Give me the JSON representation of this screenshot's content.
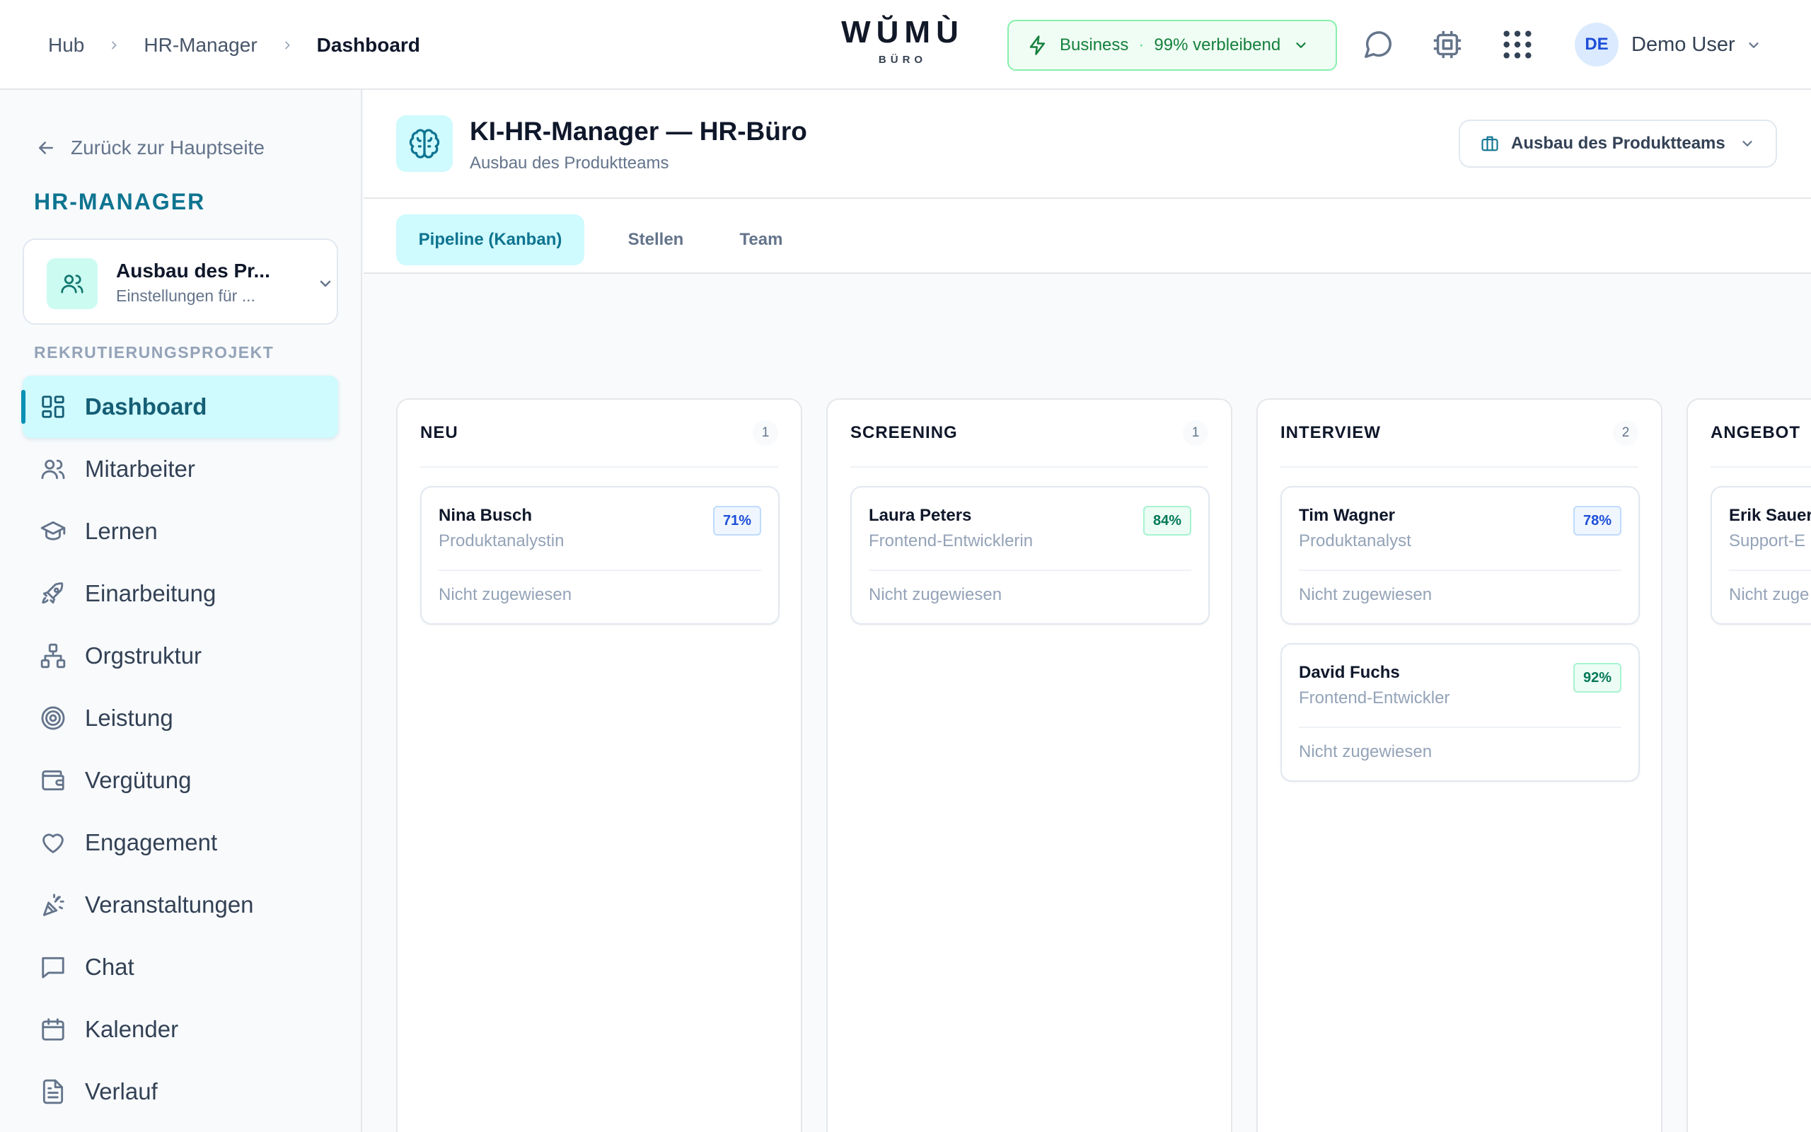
{
  "header": {
    "breadcrumb": [
      "Hub",
      "HR-Manager",
      "Dashboard"
    ],
    "logo": {
      "main": "WŬMÙ",
      "sub": "BÜRO"
    },
    "plan": {
      "name": "Business",
      "separator": "·",
      "remaining": "99% verbleibend"
    },
    "user": {
      "initials": "DE",
      "name": "Demo User"
    }
  },
  "sidebar": {
    "back_label": "Zurück zur Hauptseite",
    "brand": "HR-MANAGER",
    "project": {
      "title": "Ausbau des Pr...",
      "subtitle": "Einstellungen für ..."
    },
    "section_label": "REKRUTIERUNGSPROJEKT",
    "items": [
      {
        "label": "Dashboard",
        "icon": "dashboard-icon",
        "active": true
      },
      {
        "label": "Mitarbeiter",
        "icon": "users-icon"
      },
      {
        "label": "Lernen",
        "icon": "graduation-cap-icon"
      },
      {
        "label": "Einarbeitung",
        "icon": "rocket-icon"
      },
      {
        "label": "Orgstruktur",
        "icon": "org-chart-icon"
      },
      {
        "label": "Leistung",
        "icon": "target-icon"
      },
      {
        "label": "Vergütung",
        "icon": "wallet-icon"
      },
      {
        "label": "Engagement",
        "icon": "heart-icon"
      },
      {
        "label": "Veranstaltungen",
        "icon": "party-popper-icon"
      },
      {
        "label": "Chat",
        "icon": "chat-icon"
      },
      {
        "label": "Kalender",
        "icon": "calendar-icon"
      },
      {
        "label": "Verlauf",
        "icon": "document-icon"
      }
    ]
  },
  "page": {
    "title": "KI-HR-Manager — HR-Büro",
    "subtitle": "Ausbau des Produktteams",
    "project_select": "Ausbau des Produktteams",
    "tabs": [
      {
        "label": "Pipeline (Kanban)",
        "active": true
      },
      {
        "label": "Stellen"
      },
      {
        "label": "Team"
      }
    ]
  },
  "board": {
    "columns": [
      {
        "title": "NEU",
        "count": "1",
        "cards": [
          {
            "name": "Nina Busch",
            "role": "Produktanalystin",
            "score": "71%",
            "score_color": "#1d4ed8",
            "assignee": "Nicht zugewiesen"
          }
        ]
      },
      {
        "title": "SCREENING",
        "count": "1",
        "cards": [
          {
            "name": "Laura Peters",
            "role": "Frontend-Entwicklerin",
            "score": "84%",
            "score_color": "#047857",
            "assignee": "Nicht zugewiesen"
          }
        ]
      },
      {
        "title": "INTERVIEW",
        "count": "2",
        "cards": [
          {
            "name": "Tim Wagner",
            "role": "Produktanalyst",
            "score": "78%",
            "score_color": "#1d4ed8",
            "assignee": "Nicht zugewiesen"
          },
          {
            "name": "David Fuchs",
            "role": "Frontend-Entwickler",
            "score": "92%",
            "score_color": "#047857",
            "assignee": "Nicht zugewiesen"
          }
        ]
      },
      {
        "title": "ANGEBOT",
        "count": "",
        "cards": [
          {
            "name": "Erik Sauer",
            "role": "Support-E",
            "score": "",
            "score_color": "",
            "assignee": "Nicht zuge"
          }
        ]
      }
    ]
  },
  "colors": {
    "accent": "#0e7490",
    "active_bg": "#cffafe",
    "plan_green": "#15803d"
  }
}
